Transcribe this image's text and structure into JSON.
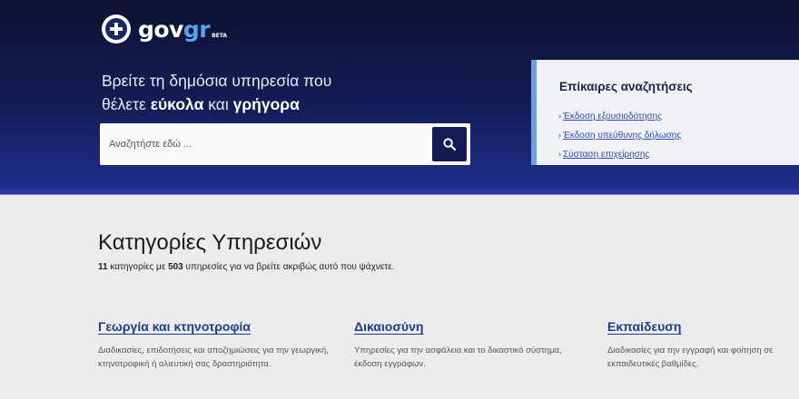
{
  "brand": {
    "gov": "gov",
    "gr": "gr",
    "beta": "BETA"
  },
  "hero": {
    "line1": "Βρείτε τη δημόσια υπηρεσία που",
    "line2_pre": "θέλετε",
    "line2_bold1": "εύκολα",
    "line2_mid": "και",
    "line2_bold2": "γρήγορα"
  },
  "search": {
    "placeholder": "Αναζητήστε εδώ ...",
    "value": ""
  },
  "trending": {
    "title": "Επίκαιρες αναζητήσεις",
    "items": [
      "Έκδοση εξουσιοδότησης",
      "Έκδοση υπεύθυνης δήλωσης",
      "Σύσταση επιχείρησης"
    ]
  },
  "categories": {
    "title": "Κατηγορίες Υπηρεσιών",
    "count_categories": "11",
    "text_mid": "κατηγορίες με",
    "count_services": "503",
    "text_end": "υπηρεσίες για να βρείτε ακριβώς αυτό που ψάχνετε.",
    "cards": [
      {
        "title": "Γεωργία και κτηνοτροφία",
        "desc": "Διαδικασίες, επιδοτήσεις και αποζημιώσεις για την γεωργική, κτηνοτροφική ή αλιευτική σας δραστηριότητα."
      },
      {
        "title": "Δικαιοσύνη",
        "desc": "Υπηρεσίες για την ασφάλεια και το δικαστικό σύστημα, έκδοση εγγράφων."
      },
      {
        "title": "Εκπαίδευση",
        "desc": "Διαδικασίες για την εγγραφή και φοίτηση σε εκπαιδευτικές βαθμίδες."
      }
    ]
  },
  "colors": {
    "hero_dark": "#0d1230",
    "hero_blue": "#1f2f8f",
    "accent": "#56a3f0",
    "link": "#2f4bb6",
    "search_button": "#141c56"
  }
}
